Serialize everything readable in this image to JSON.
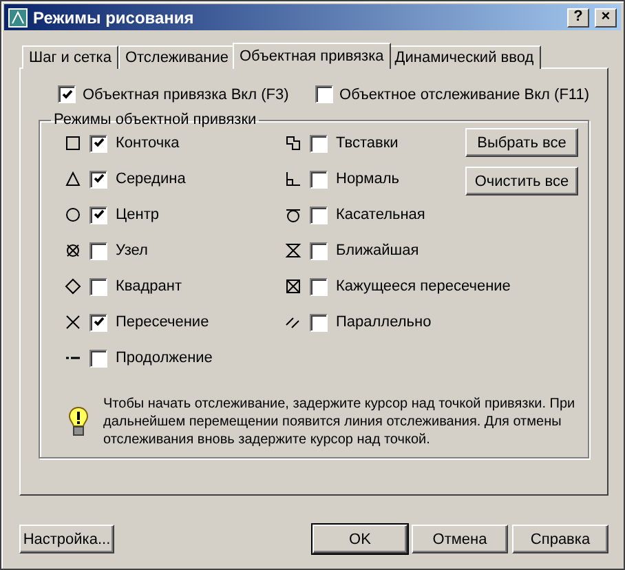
{
  "window": {
    "title": "Режимы рисования",
    "help": "?",
    "close": "×"
  },
  "tabs": [
    {
      "label": "Шаг и сетка",
      "selected": false
    },
    {
      "label": "Отслеживание",
      "selected": false
    },
    {
      "label": "Объектная привязка",
      "selected": true
    },
    {
      "label": "Динамический ввод",
      "selected": false
    }
  ],
  "top_options": [
    {
      "label": "Объектная привязка Вкл (F3)",
      "checked": true
    },
    {
      "label": "Объектное отслеживание Вкл (F11)",
      "checked": false
    }
  ],
  "modes": {
    "title": "Режимы объектной привязки",
    "left": [
      {
        "label": "Конточка",
        "checked": true
      },
      {
        "label": "Середина",
        "checked": true
      },
      {
        "label": "Центр",
        "checked": true
      },
      {
        "label": "Узел",
        "checked": false
      },
      {
        "label": "Квадрант",
        "checked": false
      },
      {
        "label": "Пересечение",
        "checked": true
      },
      {
        "label": "Продолжение",
        "checked": false
      }
    ],
    "right": [
      {
        "label": "Твставки",
        "checked": false
      },
      {
        "label": "Нормаль",
        "checked": false
      },
      {
        "label": "Касательная",
        "checked": false
      },
      {
        "label": "Ближайшая",
        "checked": false
      },
      {
        "label": "Кажущееся пересечение",
        "checked": false
      },
      {
        "label": "Параллельно",
        "checked": false
      }
    ],
    "buttons": [
      "Выбрать все",
      "Очистить все"
    ]
  },
  "hint": "Чтобы начать отслеживание, задержите курсор над точкой привязки. При дальнейшем перемещении появится линия отслеживания. Для отмены отслеживания вновь задержите курсор над точкой.",
  "footer": {
    "left": [
      "Настройка..."
    ],
    "right": [
      "OK",
      "Отмена",
      "Справка"
    ]
  }
}
